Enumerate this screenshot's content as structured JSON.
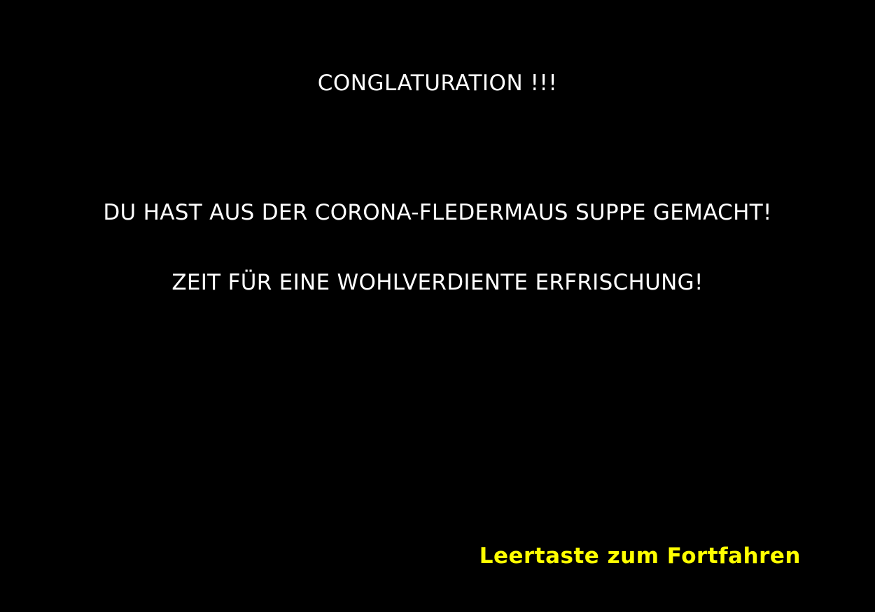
{
  "screen": {
    "background_color": "#000000",
    "text_color": "#ffffff",
    "accent_color": "#ffff00",
    "title": "CONGLATURATION !!!",
    "message_line_1": "DU HAST AUS DER CORONA-FLEDERMAUS SUPPE GEMACHT!",
    "message_line_2": "ZEIT FÜR EINE WOHLVERDIENTE ERFRISCHUNG!",
    "continue_prompt": "Leertaste zum Fortfahren"
  }
}
